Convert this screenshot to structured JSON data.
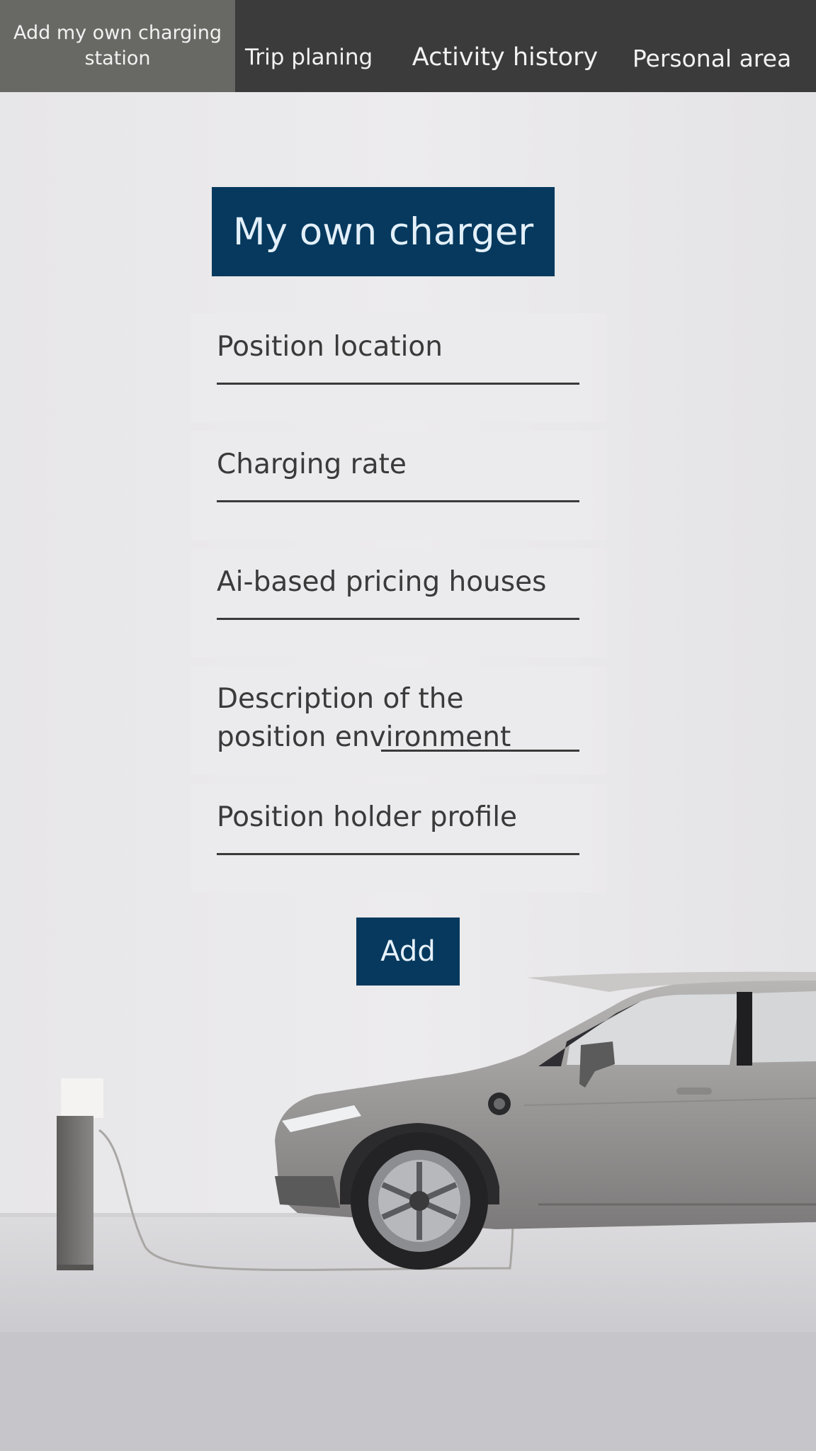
{
  "nav": {
    "items": [
      {
        "label": "Add my own charging station",
        "active": true
      },
      {
        "label": "Trip planing",
        "active": false
      },
      {
        "label": "Activity history",
        "active": false
      },
      {
        "label": "Personal area",
        "active": false
      }
    ]
  },
  "form": {
    "title": "My own charger",
    "fields": [
      {
        "label": "Position location"
      },
      {
        "label": "Charging rate"
      },
      {
        "label": "Ai-based pricing houses"
      },
      {
        "label": "Description of  the position environment"
      },
      {
        "label": "Position holder profile"
      }
    ],
    "submit_label": "Add"
  },
  "colors": {
    "nav_bg": "#3b3b3b",
    "nav_active_bg": "#686864",
    "accent": "#06395d",
    "field_bg": "#eae9eb"
  },
  "background_image": "electric-car-charging-scene"
}
